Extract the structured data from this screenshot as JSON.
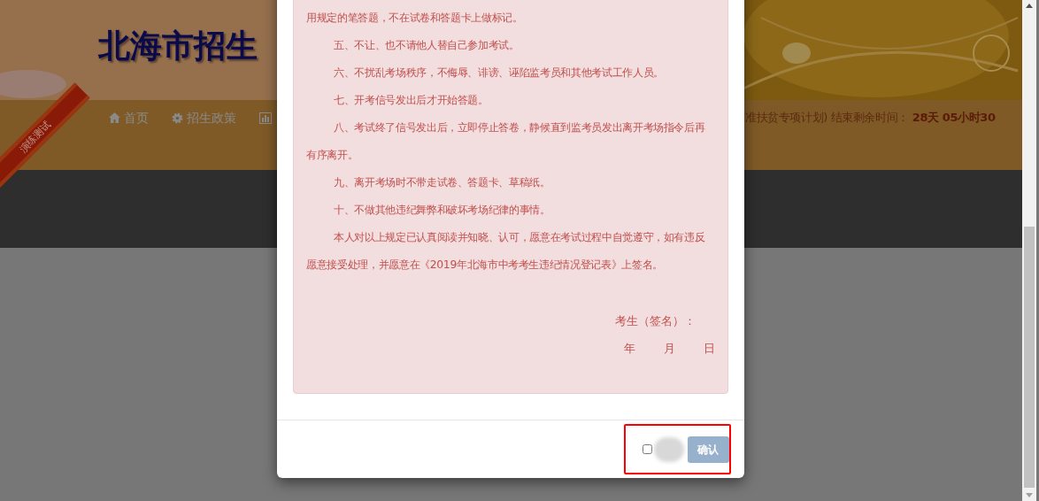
{
  "background_page": {
    "site_title": "北海市招生",
    "ribbon": "演练测试",
    "nav_items": [
      {
        "label": "首页"
      },
      {
        "label": "招生政策"
      }
    ],
    "countdown_label": "准扶贫专项计划) 结束剩余时间：",
    "countdown_value": "28天 05小时30"
  },
  "modal": {
    "paragraphs": [
      {
        "text": "用规定的笔答题，不在试卷和答题卡上做标记。",
        "indent": false
      },
      {
        "text": "五、不让、也不请他人替自己参加考试。",
        "indent": true
      },
      {
        "text": "六、不扰乱考场秩序，不侮辱、诽谤、诬陷监考员和其他考试工作人员。",
        "indent": true
      },
      {
        "text": "七、开考信号发出后才开始答题。",
        "indent": true
      },
      {
        "text": "八、考试终了信号发出后，立即停止答卷，静候直到监考员发出离开考场指令后再有序离开。",
        "indent": true
      },
      {
        "text": "九、离开考场时不带走试卷、答题卡、草稿纸。",
        "indent": true
      },
      {
        "text": "十、不做其他违纪舞弊和破坏考场纪律的事情。",
        "indent": true
      },
      {
        "text": "本人对以上规定已认真阅读并知晓、认可，愿意在考试过程中自觉遵守，如有违反愿意接受处理，并愿意在《2019年北海市中考考生违纪情况登记表》上签名。",
        "indent": true
      }
    ],
    "signature": "考生（签名）：",
    "date_parts": [
      "年",
      "月",
      "日"
    ],
    "agree_checkbox": {
      "checked": false
    },
    "confirm_button": {
      "label": "确认",
      "disabled": true
    }
  }
}
